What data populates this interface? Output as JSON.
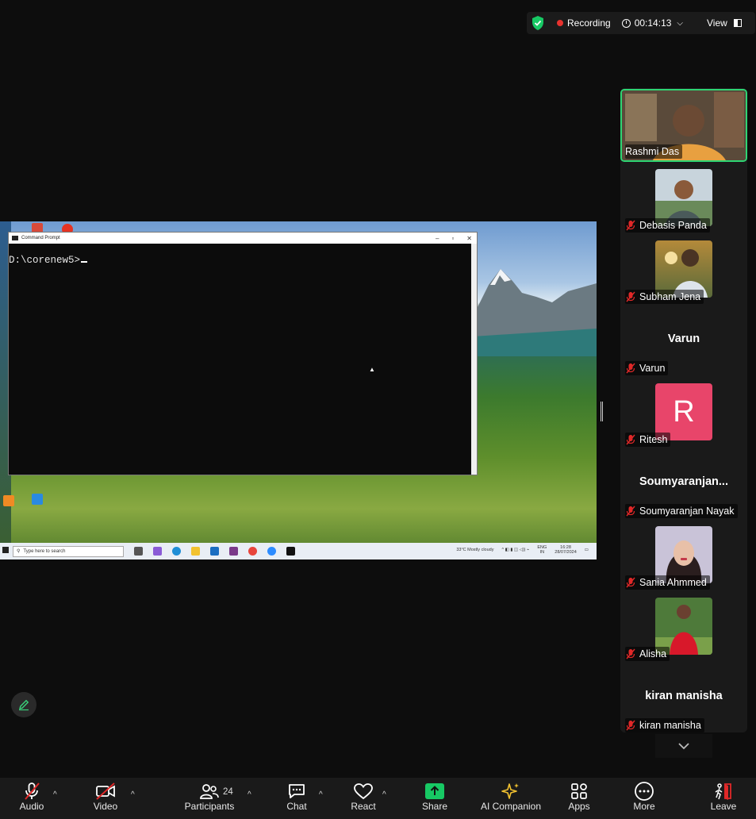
{
  "status_bar": {
    "recording_label": "Recording",
    "timer": "00:14:13",
    "view_label": "View"
  },
  "shared_screen": {
    "window_title": "Command Prompt",
    "prompt_text": "D:\\corenew5>",
    "taskbar": {
      "search_placeholder": "Type here to search",
      "weather": "33°C  Mostly cloudy",
      "language": "ENG",
      "region": "IN",
      "time": "16:28",
      "date": "28/07/2024"
    }
  },
  "participants": [
    {
      "name": "Rashmi Das",
      "type": "video",
      "active": true
    },
    {
      "name": "Debasis Panda",
      "type": "photo",
      "muted": true
    },
    {
      "name": "Subham Jena",
      "type": "photo",
      "muted": true
    },
    {
      "name": "Varun",
      "display": "Varun",
      "type": "name",
      "muted": true
    },
    {
      "name": "Ritesh",
      "letter": "R",
      "type": "letter",
      "muted": true
    },
    {
      "name": "Soumyaranjan Nayak",
      "display": "Soumyaranjan...",
      "type": "name",
      "muted": true
    },
    {
      "name": "Sania Ahmmed",
      "type": "photo",
      "muted": true
    },
    {
      "name": "Alisha",
      "type": "photo",
      "muted": true
    },
    {
      "name": "kiran manisha",
      "display": "kiran manisha",
      "type": "name",
      "muted": true
    }
  ],
  "toolbar": {
    "audio": "Audio",
    "video": "Video",
    "participants": "Participants",
    "participants_count": "24",
    "chat": "Chat",
    "react": "React",
    "share": "Share",
    "ai_companion": "AI Companion",
    "apps": "Apps",
    "more": "More",
    "leave": "Leave"
  },
  "colors": {
    "active_speaker_border": "#2ed573",
    "share_green": "#17c964",
    "recording_red": "#e8322e",
    "muted_red": "#e02828",
    "leave_red": "#e02828"
  }
}
